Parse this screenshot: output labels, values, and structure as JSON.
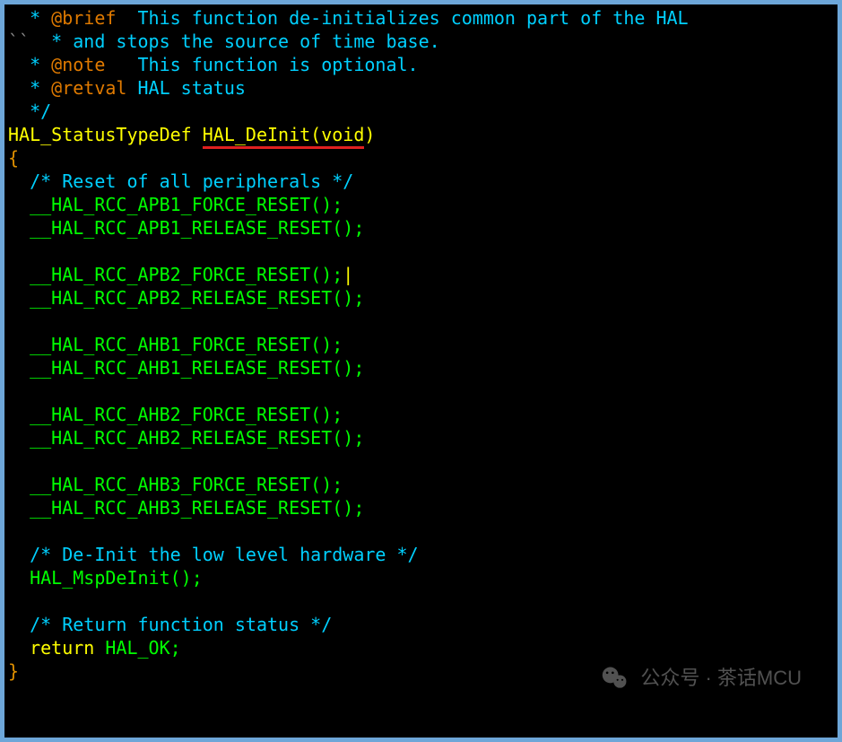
{
  "source_comment": {
    "lines": [
      {
        "prefix": "  * ",
        "tag": "@brief",
        "rest": "  This function de-initializes common part of the HAL"
      },
      {
        "prefix": "  * ",
        "tag": "",
        "rest": "and stops the source of time base."
      },
      {
        "prefix": "  * ",
        "tag": "@note",
        "rest": "   This function is optional."
      },
      {
        "prefix": "  * ",
        "tag": "@retval",
        "rest": " HAL status"
      },
      {
        "prefix": "  */",
        "tag": "",
        "rest": ""
      }
    ]
  },
  "fn_sig": {
    "return_type": "HAL_StatusTypeDef",
    "name": "HAL_DeInit",
    "param": "void"
  },
  "body": {
    "open_brace": "{",
    "comment_reset": "/* Reset of all peripherals */",
    "pairs": [
      {
        "force": "__HAL_RCC_APB1_FORCE_RESET();",
        "release": "__HAL_RCC_APB1_RELEASE_RESET();"
      },
      {
        "force": "__HAL_RCC_APB2_FORCE_RESET();",
        "release": "__HAL_RCC_APB2_RELEASE_RESET();",
        "cursor_after_force": true
      },
      {
        "force": "__HAL_RCC_AHB1_FORCE_RESET();",
        "release": "__HAL_RCC_AHB1_RELEASE_RESET();"
      },
      {
        "force": "__HAL_RCC_AHB2_FORCE_RESET();",
        "release": "__HAL_RCC_AHB2_RELEASE_RESET();"
      },
      {
        "force": "__HAL_RCC_AHB3_FORCE_RESET();",
        "release": "__HAL_RCC_AHB3_RELEASE_RESET();"
      }
    ],
    "comment_deinit": "/* De-Init the low level hardware */",
    "deinit_call": "HAL_MspDeInit();",
    "comment_return": "/* Return function status */",
    "return_kw": "return",
    "return_val": "HAL_OK",
    "return_sc": ";",
    "close_brace": "}"
  },
  "misc": {
    "backtick_col0_line2": "``"
  },
  "watermark": {
    "text": "公众号 · 茶话MCU"
  }
}
